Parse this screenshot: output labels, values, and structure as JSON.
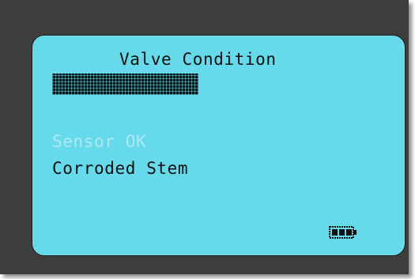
{
  "screen": {
    "title": "Valve Condition",
    "options": [
      {
        "label": "Sensor OK",
        "state": "dim"
      },
      {
        "label": "Corroded Stem",
        "state": "selected"
      }
    ]
  },
  "battery": {
    "icon": "battery-icon",
    "level_fraction": 1.0
  },
  "colors": {
    "bezel": "#3d3d3d",
    "lcd_background": "#66d9ea",
    "lcd_text": "#101010",
    "dim_text": "#aeeaf2"
  }
}
